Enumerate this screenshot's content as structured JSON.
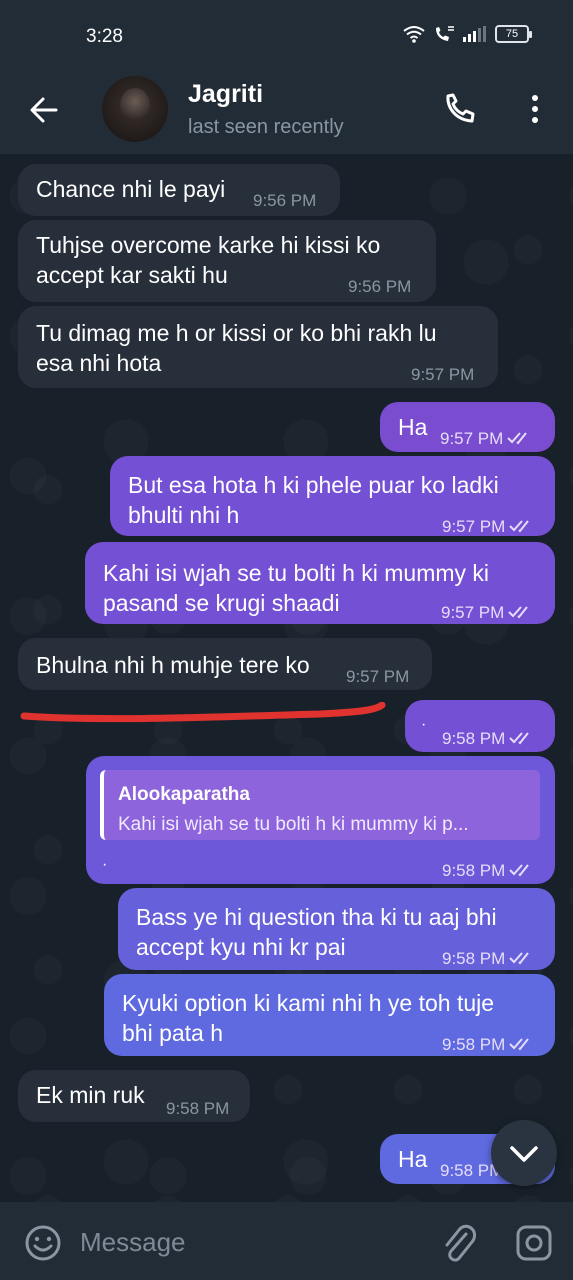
{
  "status_bar": {
    "time": "3:28",
    "battery": "75"
  },
  "header": {
    "name": "Jagriti",
    "status": "last seen recently"
  },
  "messages": [
    {
      "dir": "in",
      "lines": [
        "Chance nhi le payi"
      ],
      "time": "9:56 PM"
    },
    {
      "dir": "in",
      "lines": [
        "Tuhjse overcome karke hi kissi ko",
        "accept kar sakti hu"
      ],
      "time": "9:56 PM"
    },
    {
      "dir": "in",
      "lines": [
        "Tu dimag me h or kissi or ko bhi rakh lu",
        "esa nhi hota"
      ],
      "time": "9:57 PM"
    },
    {
      "dir": "out",
      "lines": [
        "Ha"
      ],
      "time": "9:57 PM"
    },
    {
      "dir": "out",
      "lines": [
        "But esa hota h ki phele puar ko ladki",
        "bhulti nhi h"
      ],
      "time": "9:57 PM"
    },
    {
      "dir": "out",
      "lines": [
        "Kahi isi wjah se tu bolti h ki mummy ki",
        "pasand se krugi shaadi"
      ],
      "time": "9:57 PM"
    },
    {
      "dir": "in",
      "lines": [
        "Bhulna nhi h muhje tere ko"
      ],
      "time": "9:57 PM"
    },
    {
      "dir": "out",
      "lines": [
        "·"
      ],
      "time": "9:58 PM"
    },
    {
      "dir": "out",
      "lines": [
        "·"
      ],
      "time": "9:58 PM",
      "reply": {
        "name": "Alookaparatha",
        "text": "Kahi isi wjah se tu bolti h ki mummy ki p..."
      }
    },
    {
      "dir": "out",
      "lines": [
        "Bass ye hi question tha ki tu aaj bhi",
        "accept kyu nhi kr pai"
      ],
      "time": "9:58 PM"
    },
    {
      "dir": "out",
      "lines": [
        "Kyuki option ki kami nhi h ye toh tuje",
        "bhi pata h"
      ],
      "time": "9:58 PM"
    },
    {
      "dir": "in",
      "lines": [
        "Ek min ruk"
      ],
      "time": "9:58 PM"
    },
    {
      "dir": "out",
      "lines": [
        "Ha"
      ],
      "time": "9:58 PM"
    }
  ],
  "composer": {
    "placeholder": "Message"
  },
  "icons": {
    "back": "arrow-left-icon",
    "call": "phone-icon",
    "more": "more-vertical-icon",
    "emoji": "smile-icon",
    "attach": "paperclip-icon",
    "camera": "camera-icon",
    "scroll": "chevron-down-icon",
    "read": "double-check-icon"
  },
  "colors": {
    "incoming": "#262f3a",
    "outgoing": "#7a4cd0",
    "annotation": "#e0322e"
  }
}
